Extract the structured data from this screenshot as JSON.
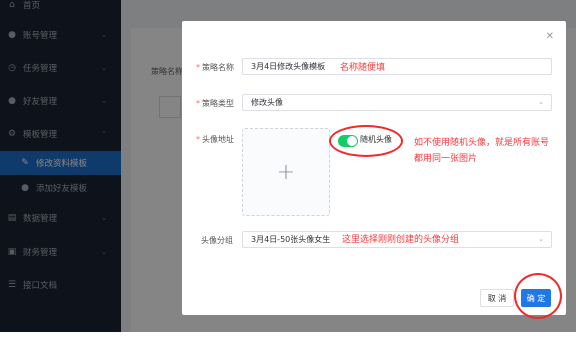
{
  "sidebar": {
    "items": [
      {
        "label": "首页",
        "icon": "home-icon",
        "active": false
      },
      {
        "label": "账号管理",
        "icon": "user-icon",
        "active": false
      },
      {
        "label": "任务管理",
        "icon": "clock-icon",
        "active": false
      },
      {
        "label": "好友管理",
        "icon": "user-icon",
        "active": false
      },
      {
        "label": "模板管理",
        "icon": "gear-icon",
        "active": false
      },
      {
        "label": "修改资料模板",
        "icon": "edit-icon",
        "active": true
      },
      {
        "label": "添加好友模板",
        "icon": "user-icon",
        "active": false
      },
      {
        "label": "数据管理",
        "icon": "database-icon",
        "active": false
      },
      {
        "label": "财务管理",
        "icon": "finance-icon",
        "active": false
      },
      {
        "label": "接口文档",
        "icon": "doc-icon",
        "active": false
      }
    ]
  },
  "main": {
    "filter_label": "策略名称"
  },
  "dialog": {
    "close_icon": "close-icon",
    "fields": {
      "name_label": "策略名称",
      "name_value": "3月4日修改头像模板",
      "type_label": "策略类型",
      "type_value": "修改头像",
      "avatar_label": "头像地址",
      "group_label": "头像分组",
      "group_value": "3月4日-50张头像女生"
    },
    "switch": {
      "label": "随机头像",
      "on": true
    },
    "buttons": {
      "cancel": "取 消",
      "confirm": "确 定"
    }
  },
  "annotations": {
    "name_note": "名称随便填",
    "random_note_line1": "如不使用随机头像，就是所有账号",
    "random_note_line2": "都用同一张图片",
    "group_note": "这里选择刚刚创建的头像分组",
    "color": "#f23b3b"
  },
  "colors": {
    "sidebar_bg": "#1c2634",
    "active_bg": "#1e6fd0",
    "primary": "#1f78e5",
    "switch_on": "#13ce66"
  }
}
